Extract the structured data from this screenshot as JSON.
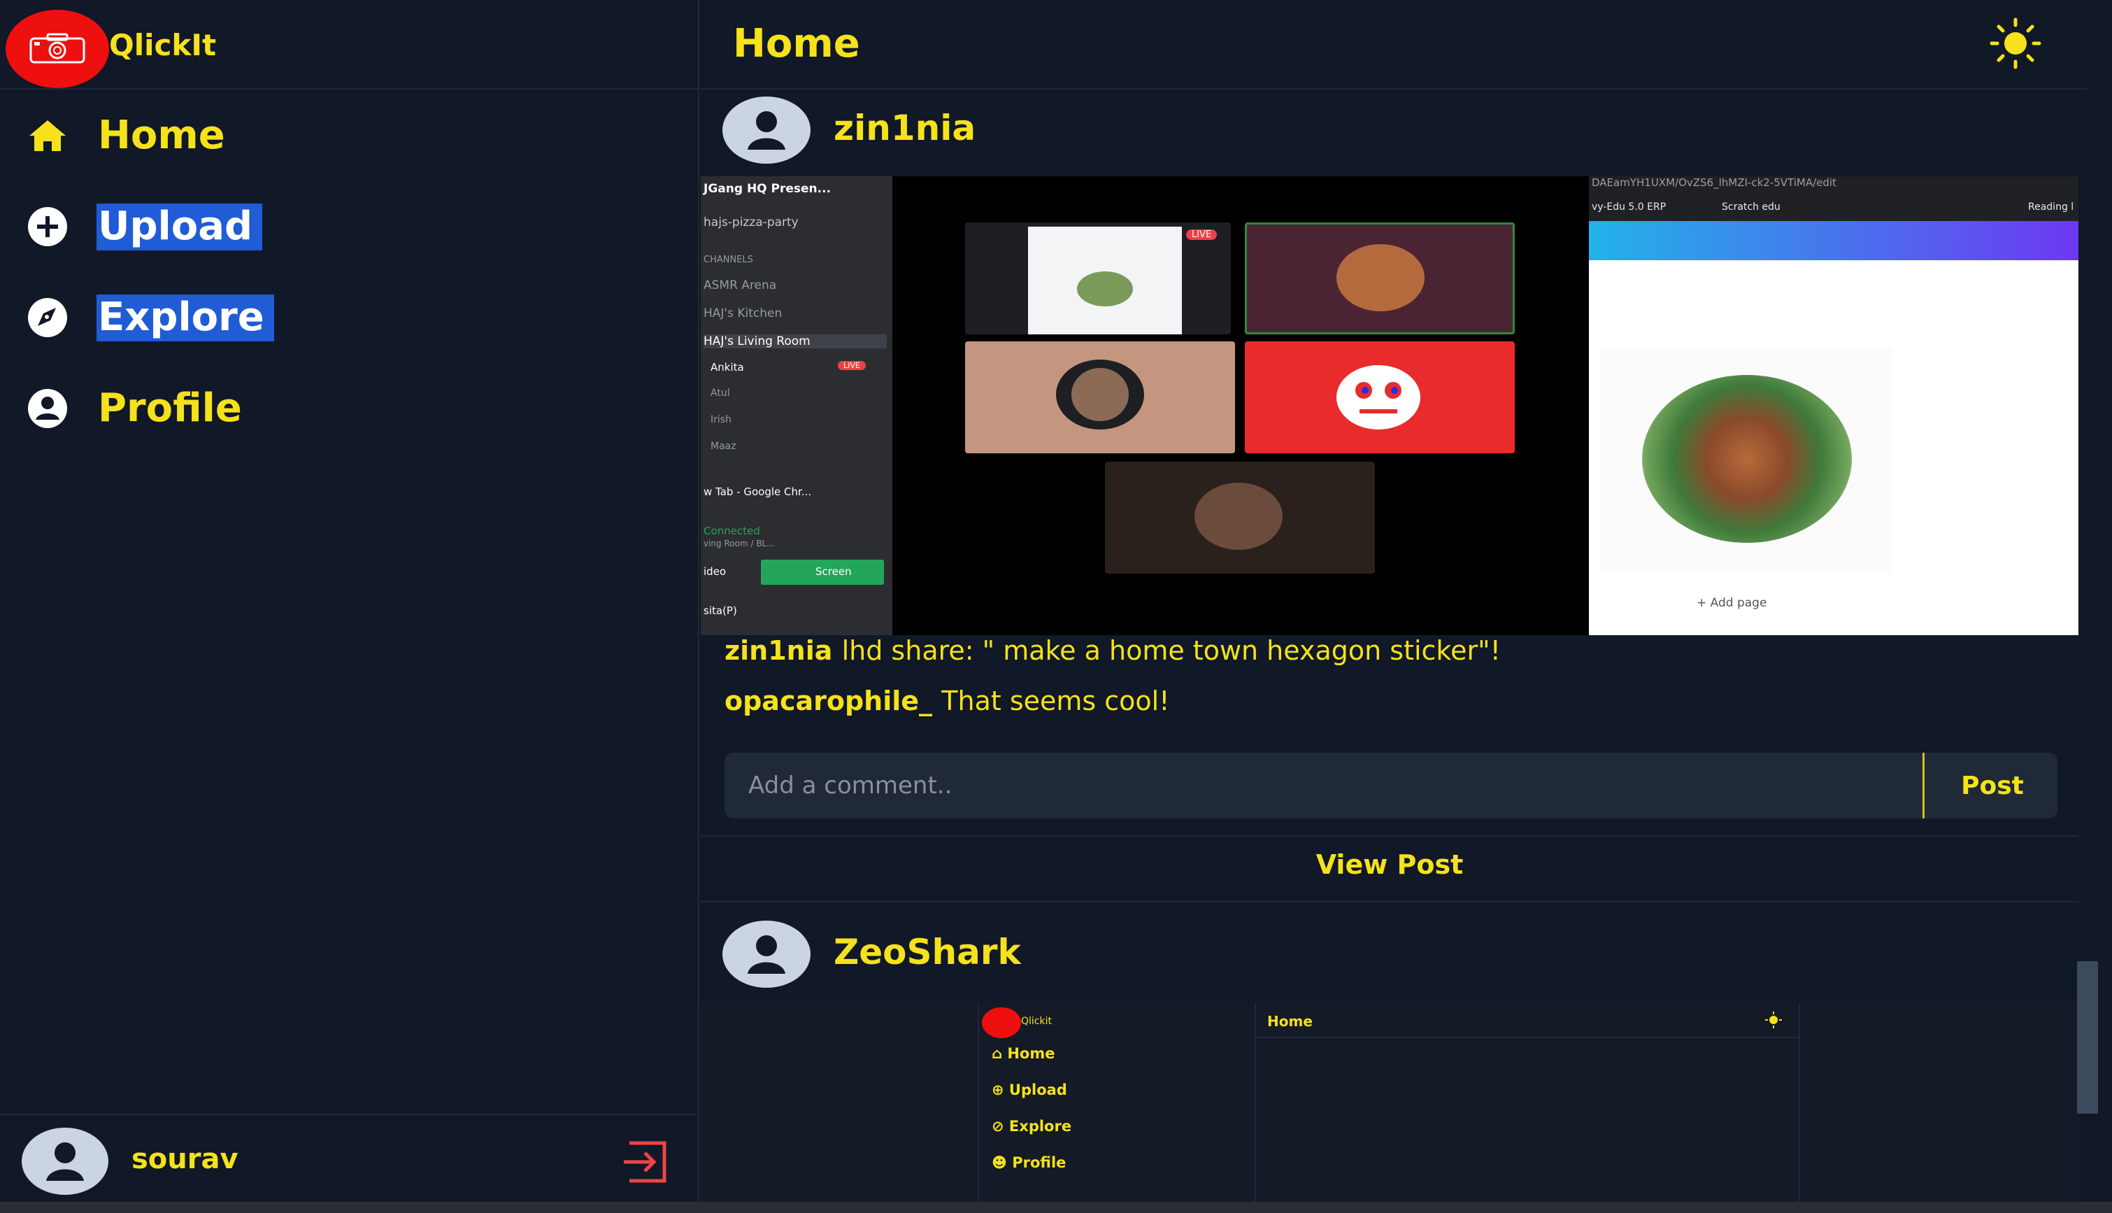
{
  "app": {
    "name": "QlickIt"
  },
  "sidebar": {
    "items": [
      {
        "label": "Home",
        "icon": "home-icon",
        "selected": false
      },
      {
        "label": "Upload",
        "icon": "plus-circle-icon",
        "selected": true
      },
      {
        "label": "Explore",
        "icon": "compass-icon",
        "selected": true
      },
      {
        "label": "Profile",
        "icon": "user-circle-icon",
        "selected": false
      }
    ]
  },
  "user": {
    "name": "sourav",
    "avatar_icon": "avatar-icon",
    "logout_icon": "logout-icon"
  },
  "header": {
    "title": "Home",
    "theme_icon": "sun-icon"
  },
  "posts": [
    {
      "author": "zin1nia",
      "caption": {
        "user": "zin1nia",
        "text": "lhd share: \" make a home town hexagon sticker\"!"
      },
      "comments": [
        {
          "user": "opacarophile_",
          "text": "That seems cool!"
        }
      ],
      "comment_placeholder": "Add a comment..",
      "post_label": "Post",
      "view_post": "View Post",
      "image": {
        "discord_lines": [
          "JGang HQ Presen...",
          "hajs-pizza-party",
          "CHANNELS",
          "ASMR Arena",
          "HAJ's Kitchen",
          "HAJ's Living Room",
          "Ankita",
          "Atul",
          "Irish",
          "Maaz",
          "w Tab - Google Chr...",
          "Connected",
          "ving Room / BL...",
          "ideo",
          "Screen",
          "sita(P)"
        ],
        "live_badge": "LIVE",
        "browser_bar": "DAEamYH1UXM/OvZS6_lhMZI-ck2-5VTiMA/edit",
        "bookmark_1": "vy-Edu 5.0 ERP",
        "bookmark_2": "Scratch edu",
        "bookmark_3": "Reading l",
        "add_page": "+ Add page"
      }
    },
    {
      "author": "ZeoShark",
      "mini": {
        "brand": "Qlickit",
        "title": "Home",
        "nav": [
          "Home",
          "Upload",
          "Explore",
          "Profile"
        ]
      }
    }
  ],
  "colors": {
    "accent": "#f5e21a",
    "background": "#111827",
    "panel": "#1f2937",
    "logo_red": "#ee0f0f",
    "selection": "#1f5cd6"
  }
}
